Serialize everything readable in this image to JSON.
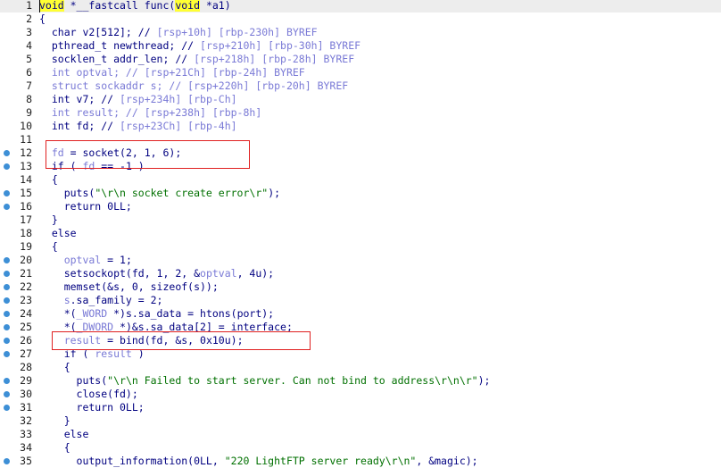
{
  "colors": {
    "keyword": "#000080",
    "variable": "#7a7ad6",
    "string": "#007000",
    "highlight": "#ffff33",
    "box": "#e02020",
    "dot": "#3d8fd6"
  },
  "lines": [
    {
      "n": "1",
      "dot": false,
      "current": true,
      "tokens": [
        {
          "t": "void",
          "c": "hl"
        },
        {
          "t": " *__fastcall func(",
          "c": "kw"
        },
        {
          "t": "void",
          "c": "hl"
        },
        {
          "t": " *a1)",
          "c": "kw"
        }
      ]
    },
    {
      "n": "2",
      "dot": false,
      "tokens": [
        {
          "t": "{",
          "c": "kw"
        }
      ]
    },
    {
      "n": "3",
      "dot": false,
      "tokens": [
        {
          "t": "  char v2[512]; // ",
          "c": "kw"
        },
        {
          "t": "[rsp+10h] [rbp-230h]",
          "c": "var"
        },
        {
          "t": " BYREF",
          "c": "var"
        }
      ]
    },
    {
      "n": "4",
      "dot": false,
      "tokens": [
        {
          "t": "  pthread_t newthread; // ",
          "c": "kw"
        },
        {
          "t": "[rsp+210h] [rbp-30h]",
          "c": "var"
        },
        {
          "t": " BYREF",
          "c": "var"
        }
      ]
    },
    {
      "n": "5",
      "dot": false,
      "tokens": [
        {
          "t": "  socklen_t addr_len; // ",
          "c": "kw"
        },
        {
          "t": "[rsp+218h] [rbp-28h]",
          "c": "var"
        },
        {
          "t": " BYREF",
          "c": "var"
        }
      ]
    },
    {
      "n": "6",
      "dot": false,
      "tokens": [
        {
          "t": "  int optval; // ",
          "c": "var"
        },
        {
          "t": "[rsp+21Ch] [rbp-24h]",
          "c": "var"
        },
        {
          "t": " BYREF",
          "c": "var"
        }
      ]
    },
    {
      "n": "7",
      "dot": false,
      "tokens": [
        {
          "t": "  struct sockaddr s; // ",
          "c": "var"
        },
        {
          "t": "[rsp+220h] [rbp-20h]",
          "c": "var"
        },
        {
          "t": " BYREF",
          "c": "var"
        }
      ]
    },
    {
      "n": "8",
      "dot": false,
      "tokens": [
        {
          "t": "  int v7; // ",
          "c": "kw"
        },
        {
          "t": "[rsp+234h] [rbp-Ch]",
          "c": "var"
        }
      ]
    },
    {
      "n": "9",
      "dot": false,
      "tokens": [
        {
          "t": "  int result; // ",
          "c": "var"
        },
        {
          "t": "[rsp+238h] [rbp-8h]",
          "c": "var"
        }
      ]
    },
    {
      "n": "10",
      "dot": false,
      "tokens": [
        {
          "t": "  int fd; // ",
          "c": "kw"
        },
        {
          "t": "[rsp+23Ch] [rbp-4h]",
          "c": "var"
        }
      ]
    },
    {
      "n": "11",
      "dot": false,
      "tokens": [
        {
          "t": "",
          "c": "kw"
        }
      ]
    },
    {
      "n": "12",
      "dot": true,
      "tokens": [
        {
          "t": "  fd",
          "c": "var"
        },
        {
          "t": " = socket(2, 1, 6);",
          "c": "kw"
        }
      ]
    },
    {
      "n": "13",
      "dot": true,
      "tokens": [
        {
          "t": "  if ( ",
          "c": "kw"
        },
        {
          "t": "fd",
          "c": "var"
        },
        {
          "t": " == -1 )",
          "c": "kw"
        }
      ]
    },
    {
      "n": "14",
      "dot": false,
      "tokens": [
        {
          "t": "  {",
          "c": "kw"
        }
      ]
    },
    {
      "n": "15",
      "dot": true,
      "tokens": [
        {
          "t": "    puts(",
          "c": "kw"
        },
        {
          "t": "\"\\r\\n socket create error\\r\"",
          "c": "str"
        },
        {
          "t": ");",
          "c": "kw"
        }
      ]
    },
    {
      "n": "16",
      "dot": true,
      "tokens": [
        {
          "t": "    return 0LL;",
          "c": "kw"
        }
      ]
    },
    {
      "n": "17",
      "dot": false,
      "tokens": [
        {
          "t": "  }",
          "c": "kw"
        }
      ]
    },
    {
      "n": "18",
      "dot": false,
      "tokens": [
        {
          "t": "  else",
          "c": "kw"
        }
      ]
    },
    {
      "n": "19",
      "dot": false,
      "tokens": [
        {
          "t": "  {",
          "c": "kw"
        }
      ]
    },
    {
      "n": "20",
      "dot": true,
      "tokens": [
        {
          "t": "    optval",
          "c": "var"
        },
        {
          "t": " = 1;",
          "c": "kw"
        }
      ]
    },
    {
      "n": "21",
      "dot": true,
      "tokens": [
        {
          "t": "    setsockopt(fd, 1, 2, &",
          "c": "kw"
        },
        {
          "t": "optval",
          "c": "var"
        },
        {
          "t": ", 4u);",
          "c": "kw"
        }
      ]
    },
    {
      "n": "22",
      "dot": true,
      "tokens": [
        {
          "t": "    memset(&s, 0, sizeof(s));",
          "c": "kw"
        }
      ]
    },
    {
      "n": "23",
      "dot": true,
      "tokens": [
        {
          "t": "    s",
          "c": "var"
        },
        {
          "t": ".sa_family = 2;",
          "c": "kw"
        }
      ]
    },
    {
      "n": "24",
      "dot": true,
      "tokens": [
        {
          "t": "    *(",
          "c": "kw"
        },
        {
          "t": "_WORD",
          "c": "var"
        },
        {
          "t": " *)s.sa_data = htons(port);",
          "c": "kw"
        }
      ]
    },
    {
      "n": "25",
      "dot": true,
      "tokens": [
        {
          "t": "    *(",
          "c": "kw"
        },
        {
          "t": "_DWORD",
          "c": "var"
        },
        {
          "t": " *)&s.sa_data[2] = interface;",
          "c": "kw"
        }
      ]
    },
    {
      "n": "26",
      "dot": true,
      "tokens": [
        {
          "t": "    result",
          "c": "var"
        },
        {
          "t": " = bind(fd, &s, 0x10u);",
          "c": "kw"
        }
      ]
    },
    {
      "n": "27",
      "dot": true,
      "tokens": [
        {
          "t": "    if ( ",
          "c": "kw"
        },
        {
          "t": "result",
          "c": "var"
        },
        {
          "t": " )",
          "c": "kw"
        }
      ]
    },
    {
      "n": "28",
      "dot": false,
      "tokens": [
        {
          "t": "    {",
          "c": "kw"
        }
      ]
    },
    {
      "n": "29",
      "dot": true,
      "tokens": [
        {
          "t": "      puts(",
          "c": "kw"
        },
        {
          "t": "\"\\r\\n Failed to start server. Can not bind to address\\r\\n\\r\"",
          "c": "str"
        },
        {
          "t": ");",
          "c": "kw"
        }
      ]
    },
    {
      "n": "30",
      "dot": true,
      "tokens": [
        {
          "t": "      close(fd);",
          "c": "kw"
        }
      ]
    },
    {
      "n": "31",
      "dot": true,
      "tokens": [
        {
          "t": "      return 0LL;",
          "c": "kw"
        }
      ]
    },
    {
      "n": "32",
      "dot": false,
      "tokens": [
        {
          "t": "    }",
          "c": "kw"
        }
      ]
    },
    {
      "n": "33",
      "dot": false,
      "tokens": [
        {
          "t": "    else",
          "c": "kw"
        }
      ]
    },
    {
      "n": "34",
      "dot": false,
      "tokens": [
        {
          "t": "    {",
          "c": "kw"
        }
      ]
    },
    {
      "n": "35",
      "dot": true,
      "tokens": [
        {
          "t": "      output_information(0LL, ",
          "c": "kw"
        },
        {
          "t": "\"220 LightFTP server ready\\r\\n\"",
          "c": "str"
        },
        {
          "t": ", &magic);",
          "c": "kw"
        }
      ]
    }
  ]
}
